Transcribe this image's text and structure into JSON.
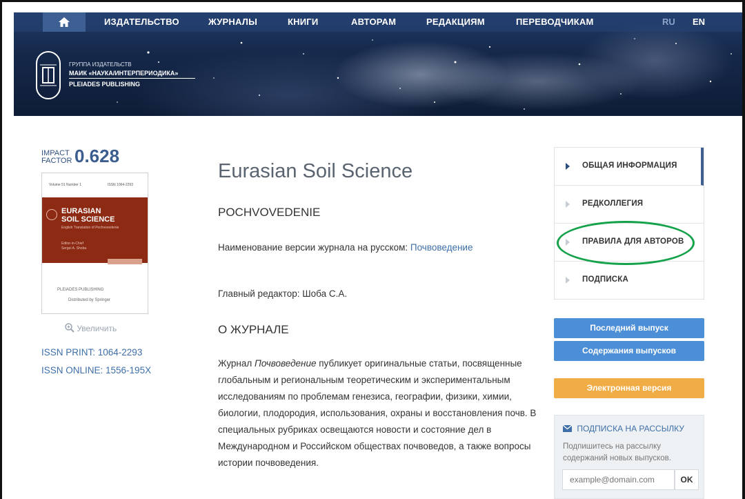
{
  "nav": {
    "items": [
      "ИЗДАТЕЛЬСТВО",
      "ЖУРНАЛЫ",
      "КНИГИ",
      "АВТОРАМ",
      "РЕДАКЦИЯМ",
      "ПЕРЕВОДЧИКАМ"
    ],
    "lang_ru": "RU",
    "lang_en": "EN",
    "home_icon": "home-icon"
  },
  "logo": {
    "line1": "ГРУППА ИЗДАТЕЛЬСТВ",
    "line2": "МАИК «НАУКА/ИНТЕРПЕРИОДИКА»",
    "line3": "PLEIADES PUBLISHING",
    "emblem_top": "МАИК",
    "emblem_bottom": "НАУКА"
  },
  "impact": {
    "label_line1": "IMPACT",
    "label_line2": "FACTOR",
    "value": "0.628"
  },
  "cover": {
    "title_line1": "EURASIAN",
    "title_line2": "SOIL SCIENCE",
    "subtitle": "English Translation of Pochvovedenie",
    "author_line1": "Editor-in-Chief",
    "author_line2": "Sergei A. Shoba",
    "hdr_left": "Volume 51 Number 1",
    "hdr_right": "ISSN 1064-2293",
    "foot_pub": "PLEIADES PUBLISHING",
    "foot_dist": "Distributed by Springer"
  },
  "zoom_label": "Увеличить",
  "issn": {
    "print": "ISSN PRINT: 1064-2293",
    "online": "ISSN ONLINE: 1556-195X"
  },
  "journal": {
    "title": "Eurasian Soil Science",
    "subtitle": "POCHVOVEDENIE",
    "russian_version_label": "Наименование версии журнала на русском:",
    "russian_version_link": "Почвоведение",
    "editor": "Главный редактор: Шоба С.А.",
    "about_title": "О ЖУРНАЛЕ",
    "about_prefix": "Журнал",
    "about_italic": "Почвоведение",
    "about_text": " публикует оригинальные статьи, посвященные глобальным и региональным теоретическим и экспериментальным исследованиям по проблемам генезиса, географии, физики, химии, биологии, плодородия, использования, охраны и восстановления почв. В специальных рубриках освещаются новости и состояние дел в Международном и Российском обществах почвоведов, а также вопросы истории почвоведения."
  },
  "menu": {
    "items": [
      "ОБЩАЯ ИНФОРМАЦИЯ",
      "РЕДКОЛЛЕГИЯ",
      "ПРАВИЛА ДЛЯ АВТОРОВ",
      "ПОДПИСКА"
    ]
  },
  "buttons": {
    "latest_issue": "Последний выпуск",
    "issue_contents": "Содержания выпусков",
    "electronic": "Электронная версия"
  },
  "newsletter": {
    "title": "ПОДПИСКА НА РАССЫЛКУ",
    "text": "Подпишитесь на рассылку содержаний новых выпусков.",
    "placeholder": "example@domain.com",
    "ok": "OK"
  },
  "colors": {
    "accent_blue": "#4d8fd6",
    "orange": "#f0ad45",
    "link": "#3e6fa8",
    "highlight_green": "#14a24a",
    "cover_red": "#8c2a14"
  }
}
